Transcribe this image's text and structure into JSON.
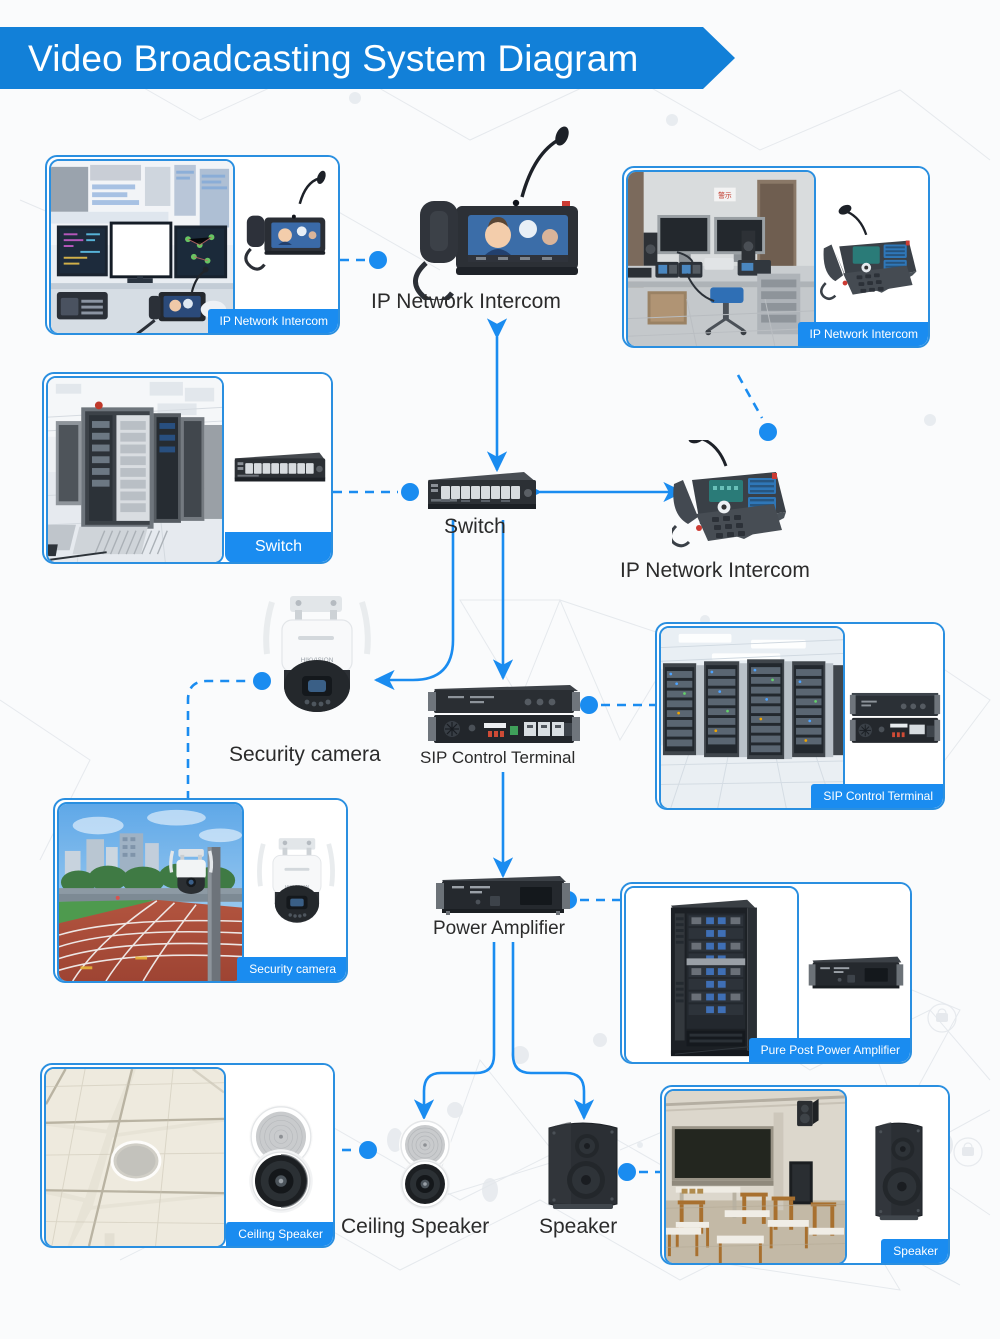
{
  "page": {
    "title": "Video Broadcasting System Diagram",
    "accent_blue": "#1280d8",
    "link_blue": "#1a8cf0",
    "background": "#fafbfc",
    "label_text_color": "#2b2b2b"
  },
  "banner": {
    "title": "Video Broadcasting System Diagram"
  },
  "cards": [
    {
      "id": "card-intercom-control-room",
      "label": "IP Network Intercom",
      "label_style": "right",
      "photo": "control-room-monitors",
      "product": "desk-intercom-with-gooseneck-mic"
    },
    {
      "id": "card-intercom-office",
      "label": "IP Network Intercom",
      "label_style": "right",
      "photo": "office-desk-dual-monitors",
      "product": "ip-desk-phone-with-mic"
    },
    {
      "id": "card-switch",
      "label": "Switch",
      "label_style": "center",
      "photo": "server-room-racks",
      "product": "network-switch-8-port"
    },
    {
      "id": "card-sip-control-terminal",
      "label": "SIP Control Terminal",
      "label_style": "right",
      "photo": "data-center-aisle",
      "product": "rack-mount-sip-terminal"
    },
    {
      "id": "card-security-camera",
      "label": "Security camera",
      "label_style": "right",
      "photo": "running-track-stadium-camera-pole",
      "product": "ptz-dome-camera-white"
    },
    {
      "id": "card-power-amplifier",
      "label": "Pure Post Power Amplifier",
      "label_style": "right",
      "photo": "black-equipment-rack-cabinet",
      "product": "rack-mount-power-amplifier"
    },
    {
      "id": "card-ceiling-speaker",
      "label": "Ceiling Speaker",
      "label_style": "right",
      "photo": "suspended-ceiling-with-speaker",
      "product": "round-ceiling-speaker-pair"
    },
    {
      "id": "card-speaker",
      "label": "Speaker",
      "label_style": "right",
      "photo": "classroom-with-wall-speaker",
      "product": "wall-mount-box-speaker"
    }
  ],
  "nodes": [
    {
      "id": "node-ip-network-intercom-top",
      "label": "IP Network Intercom",
      "icon": "desk-intercom-device",
      "font_size": 21
    },
    {
      "id": "node-switch-center",
      "label": "Switch",
      "icon": "network-switch-device",
      "font_size": 21
    },
    {
      "id": "node-ip-network-intercom-right",
      "label": "IP Network Intercom",
      "icon": "ip-desk-phone-device",
      "font_size": 21
    },
    {
      "id": "node-security-camera",
      "label": "Security camera",
      "icon": "ptz-dome-camera-device",
      "font_size": 21
    },
    {
      "id": "node-sip-control-terminal",
      "label": "SIP Control Terminal",
      "icon": "rack-sip-terminal-device",
      "font_size": 17
    },
    {
      "id": "node-power-amplifier",
      "label": "Power Amplifier",
      "icon": "rack-power-amplifier-device",
      "font_size": 19
    },
    {
      "id": "node-ceiling-speaker",
      "label": "Ceiling Speaker",
      "icon": "round-ceiling-speaker-device",
      "font_size": 21
    },
    {
      "id": "node-speaker",
      "label": "Speaker",
      "icon": "box-speaker-device",
      "font_size": 21
    }
  ],
  "connectors": {
    "dashed_color": "#1a8cf0",
    "solid_color": "#1a8cf0",
    "dot_color": "#1a8cf0",
    "links": [
      {
        "from": "card-intercom-control-room",
        "to": "node-ip-network-intercom-top",
        "style": "dashed-dot"
      },
      {
        "from": "card-intercom-office",
        "to": "node-ip-network-intercom-right",
        "style": "dashed-dot"
      },
      {
        "from": "node-ip-network-intercom-top",
        "to": "node-switch-center",
        "style": "double-arrow"
      },
      {
        "from": "card-switch",
        "to": "node-switch-center",
        "style": "dashed-dot"
      },
      {
        "from": "node-switch-center",
        "to": "node-ip-network-intercom-right",
        "style": "double-arrow"
      },
      {
        "from": "node-switch-center",
        "to": "node-security-camera",
        "style": "arrow"
      },
      {
        "from": "node-switch-center",
        "to": "node-sip-control-terminal",
        "style": "arrow"
      },
      {
        "from": "card-security-camera",
        "to": "node-security-camera",
        "style": "dashed-dot"
      },
      {
        "from": "node-sip-control-terminal",
        "to": "card-sip-control-terminal",
        "style": "dashed-dot"
      },
      {
        "from": "node-sip-control-terminal",
        "to": "node-power-amplifier",
        "style": "arrow"
      },
      {
        "from": "node-power-amplifier",
        "to": "card-power-amplifier",
        "style": "dashed-dot"
      },
      {
        "from": "node-power-amplifier",
        "to": "node-ceiling-speaker",
        "style": "arrow"
      },
      {
        "from": "node-power-amplifier",
        "to": "node-speaker",
        "style": "arrow"
      },
      {
        "from": "card-ceiling-speaker",
        "to": "node-ceiling-speaker",
        "style": "dashed-dot"
      },
      {
        "from": "node-speaker",
        "to": "card-speaker",
        "style": "dashed-dot"
      }
    ]
  }
}
